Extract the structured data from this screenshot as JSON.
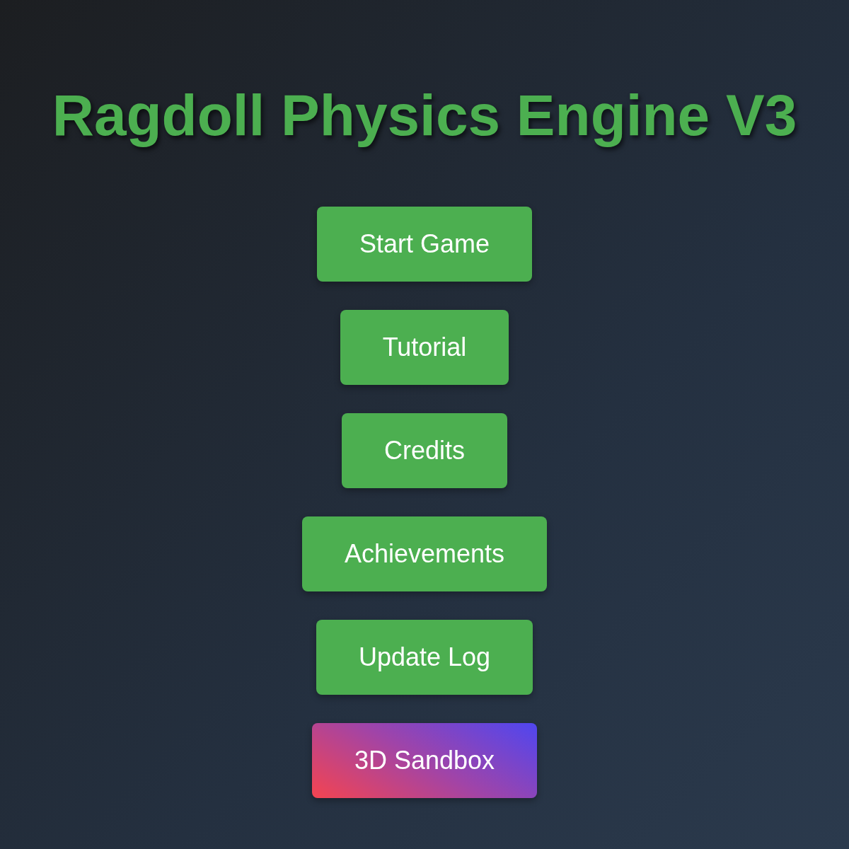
{
  "title": "Ragdoll Physics Engine V3",
  "buttons": [
    {
      "label": "Start Game",
      "kind": "standard"
    },
    {
      "label": "Tutorial",
      "kind": "standard"
    },
    {
      "label": "Credits",
      "kind": "standard"
    },
    {
      "label": "Achievements",
      "kind": "standard"
    },
    {
      "label": "Update Log",
      "kind": "standard"
    },
    {
      "label": "3D Sandbox",
      "kind": "special"
    }
  ]
}
